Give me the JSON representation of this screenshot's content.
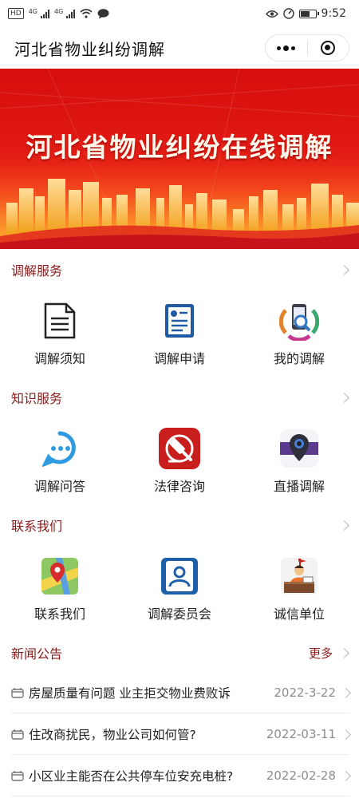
{
  "status_bar": {
    "chip_label": "HD",
    "signal_one_label": "4G",
    "signal_two_label": "4G",
    "time": "9:52"
  },
  "navbar": {
    "title": "河北省物业纠纷调解"
  },
  "banner": {
    "title": "河北省物业纠纷在线调解",
    "colors": {
      "top": "#d60d0d",
      "bottom": "#f6a21c"
    }
  },
  "sections": {
    "mediation": {
      "title": "调解服务",
      "items": [
        {
          "label": "调解须知",
          "icon": "document-icon"
        },
        {
          "label": "调解申请",
          "icon": "application-form-icon"
        },
        {
          "label": "我的调解",
          "icon": "phone-search-icon"
        }
      ]
    },
    "knowledge": {
      "title": "知识服务",
      "items": [
        {
          "label": "调解问答",
          "icon": "chat-bubble-icon"
        },
        {
          "label": "法律咨询",
          "icon": "gavel-icon"
        },
        {
          "label": "直播调解",
          "icon": "live-camera-icon"
        }
      ]
    },
    "contact": {
      "title": "联系我们",
      "items": [
        {
          "label": "联系我们",
          "icon": "map-pin-icon"
        },
        {
          "label": "调解委员会",
          "icon": "person-id-icon"
        },
        {
          "label": "诚信单位",
          "icon": "desk-person-icon"
        }
      ]
    },
    "news": {
      "title": "新闻公告",
      "more_label": "更多",
      "items": [
        {
          "title": "房屋质量有问题 业主拒交物业费败诉",
          "date": "2022-3-22"
        },
        {
          "title": "住改商扰民，物业公司如何管?",
          "date": "2022-03-11"
        },
        {
          "title": "小区业主能否在公共停车位安充电桩?",
          "date": "2022-02-28"
        }
      ]
    }
  },
  "colors": {
    "section_title": "#8a1a1a",
    "accent_red": "#c81e1e"
  }
}
